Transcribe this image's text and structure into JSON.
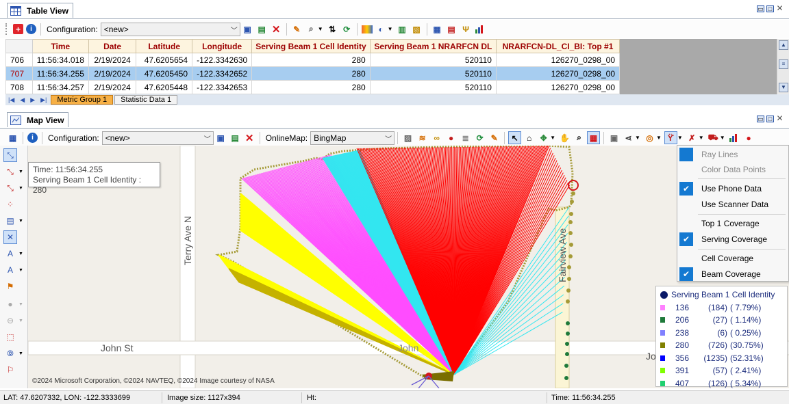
{
  "table_view": {
    "title": "Table View",
    "configuration_label": "Configuration:",
    "configuration_value": "<new>",
    "columns": [
      "Time",
      "Date",
      "Latitude",
      "Longitude",
      "Serving Beam 1 Cell Identity",
      "Serving Beam 1 NRARFCN DL",
      "NRARFCN-DL_CI_BI: Top #1"
    ],
    "rows": [
      {
        "num": "706",
        "time": "11:56:34.018",
        "date": "2/19/2024",
        "lat": "47.6205654",
        "lon": "-122.3342630",
        "cell": "280",
        "arfcn": "520110",
        "top": "126270_0298_00"
      },
      {
        "num": "707",
        "time": "11:56:34.255",
        "date": "2/19/2024",
        "lat": "47.6205450",
        "lon": "-122.3342652",
        "cell": "280",
        "arfcn": "520110",
        "top": "126270_0298_00"
      },
      {
        "num": "708",
        "time": "11:56:34.257",
        "date": "2/19/2024",
        "lat": "47.6205448",
        "lon": "-122.3342653",
        "cell": "280",
        "arfcn": "520110",
        "top": "126270_0298_00"
      }
    ],
    "sheet_tabs": [
      "Metric Group 1",
      "Statistic Data 1"
    ]
  },
  "map_view": {
    "title": "Map View",
    "configuration_label": "Configuration:",
    "configuration_value": "<new>",
    "online_map_label": "OnlineMap:",
    "online_map_value": "BingMap",
    "tooltip": {
      "line1": "Time: 11:56:34.255",
      "line2": "Serving Beam 1 Cell Identity : 280"
    },
    "streets": [
      "Terry Ave N",
      "John St",
      "Fairview Ave",
      "John",
      "Jo"
    ],
    "copyright": "©2024 Microsoft Corporation, ©2024 NAVTEQ, ©2024 Image courtesy of NASA"
  },
  "menu": {
    "items": [
      {
        "label": "Ray Lines",
        "checked": false,
        "disabled": true,
        "highlighted": true
      },
      {
        "label": "Color Data Points",
        "checked": false,
        "disabled": true
      },
      {
        "label": "Use Phone Data",
        "checked": true
      },
      {
        "label": "Use Scanner Data",
        "checked": false
      },
      {
        "label": "Top 1 Coverage",
        "checked": false
      },
      {
        "label": "Serving Coverage",
        "checked": true
      },
      {
        "label": "Cell Coverage",
        "checked": false
      },
      {
        "label": "Beam Coverage",
        "checked": true
      }
    ]
  },
  "legend": {
    "title": "Serving Beam 1 Cell Identity",
    "rows": [
      {
        "code": "136",
        "count": "(184)",
        "pct": "( 7.79%)",
        "color": "#ff80ff"
      },
      {
        "code": "206",
        "count": "(27)",
        "pct": "( 1.14%)",
        "color": "#1f7a3a"
      },
      {
        "code": "238",
        "count": "(6)",
        "pct": "( 0.25%)",
        "color": "#8080ff"
      },
      {
        "code": "280",
        "count": "(726)",
        "pct": "(30.75%)",
        "color": "#808000"
      },
      {
        "code": "356",
        "count": "(1235)",
        "pct": "(52.31%)",
        "color": "#0000ff"
      },
      {
        "code": "391",
        "count": "(57)",
        "pct": "( 2.41%)",
        "color": "#80ff00"
      },
      {
        "code": "407",
        "count": "(126)",
        "pct": "( 5.34%)",
        "color": "#20d070"
      }
    ]
  },
  "status_bar": {
    "coords": "LAT: 47.6207332, LON: -122.3333699",
    "image_size": "Image size: 1127x394",
    "ht": "Ht:",
    "time": "Time: 11:56:34.255"
  },
  "colors": {
    "beam_red": "#ff0000",
    "beam_cyan": "#33e6f0",
    "beam_magenta": "#ff4dff",
    "beam_yellow": "#ffff00",
    "selection_blue": "#a7cdf0",
    "menu_check": "#1479d1"
  }
}
